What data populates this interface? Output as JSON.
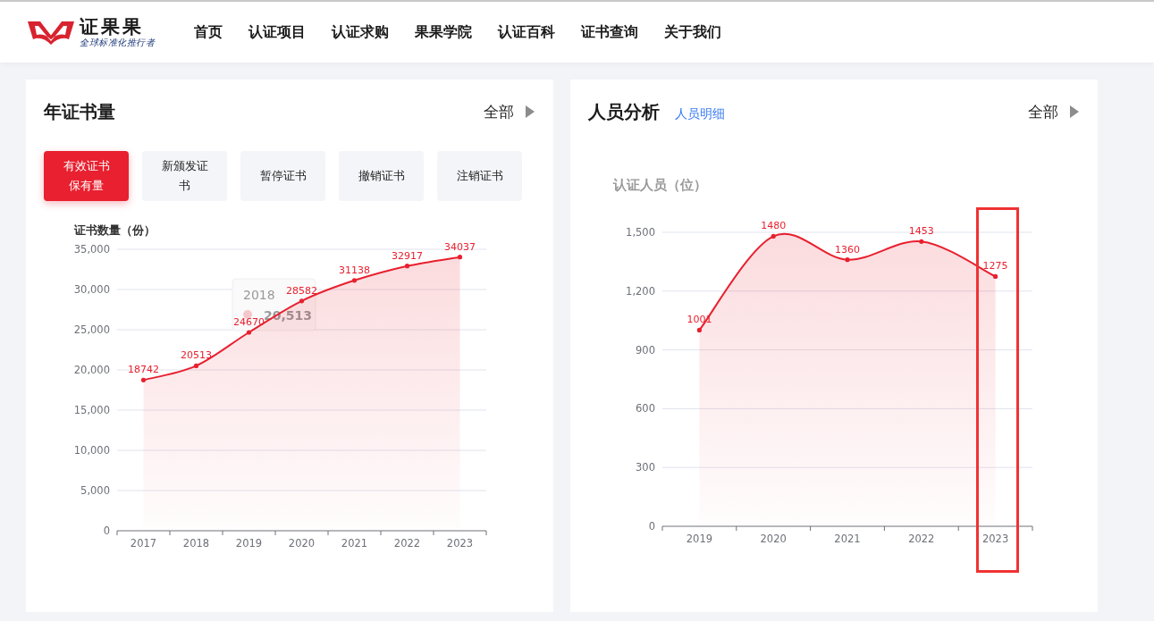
{
  "header": {
    "logo": {
      "name": "证果果",
      "slogan": "全球标准化推行者"
    },
    "nav": [
      {
        "label": "首页"
      },
      {
        "label": "认证项目"
      },
      {
        "label": "认证求购"
      },
      {
        "label": "果果学院"
      },
      {
        "label": "认证百科"
      },
      {
        "label": "证书查询"
      },
      {
        "label": "关于我们"
      }
    ]
  },
  "panels": [
    {
      "title": "年证书量",
      "more": "全部",
      "buttons": [
        {
          "label": "有效证书保有量",
          "selected": true
        },
        {
          "label": "新颁发证书",
          "selected": false
        },
        {
          "label": "暂停证书",
          "selected": false
        },
        {
          "label": "撤销证书",
          "selected": false
        },
        {
          "label": "注销证书",
          "selected": false
        }
      ],
      "tooltip": {
        "title": "2018",
        "value": "20,513"
      },
      "chart_data": {
        "type": "area",
        "ylabel": "证书数量（份）",
        "categories": [
          "2017",
          "2018",
          "2019",
          "2020",
          "2021",
          "2022",
          "2023"
        ],
        "series": [
          {
            "color": "#e8202f",
            "values": [
              18742,
              20513,
              24670,
              28582,
              31138,
              32917,
              34037
            ]
          }
        ],
        "grid": true,
        "ylim": [
          0,
          35000
        ],
        "yticks": [
          {
            "value": 0,
            "label": "0"
          },
          {
            "value": 5000,
            "label": "5,000"
          },
          {
            "value": 10000,
            "label": "10,000"
          },
          {
            "value": 15000,
            "label": "15,000"
          },
          {
            "value": 20000,
            "label": "20,000"
          },
          {
            "value": 25000,
            "label": "25,000"
          },
          {
            "value": 30000,
            "label": "30,000"
          },
          {
            "value": 35000,
            "label": "35,000"
          }
        ],
        "data_labels": true
      }
    },
    {
      "title": "人员分析",
      "link": "人员明细",
      "more": "全部",
      "highlight_last": true,
      "chart_data": {
        "type": "area",
        "ylabel": "认证人员（位）",
        "categories": [
          "2019",
          "2020",
          "2021",
          "2022",
          "2023"
        ],
        "series": [
          {
            "color": "#e8202f",
            "values": [
              1001,
              1480,
              1360,
              1453,
              1275
            ]
          }
        ],
        "grid": true,
        "ylim": [
          0,
          1500
        ],
        "yticks": [
          {
            "value": 0,
            "label": "0"
          },
          {
            "value": 300,
            "label": "300"
          },
          {
            "value": 600,
            "label": "600"
          },
          {
            "value": 900,
            "label": "900"
          },
          {
            "value": 1200,
            "label": "1,200"
          },
          {
            "value": 1500,
            "label": "1,500"
          }
        ],
        "data_labels": true
      }
    }
  ]
}
